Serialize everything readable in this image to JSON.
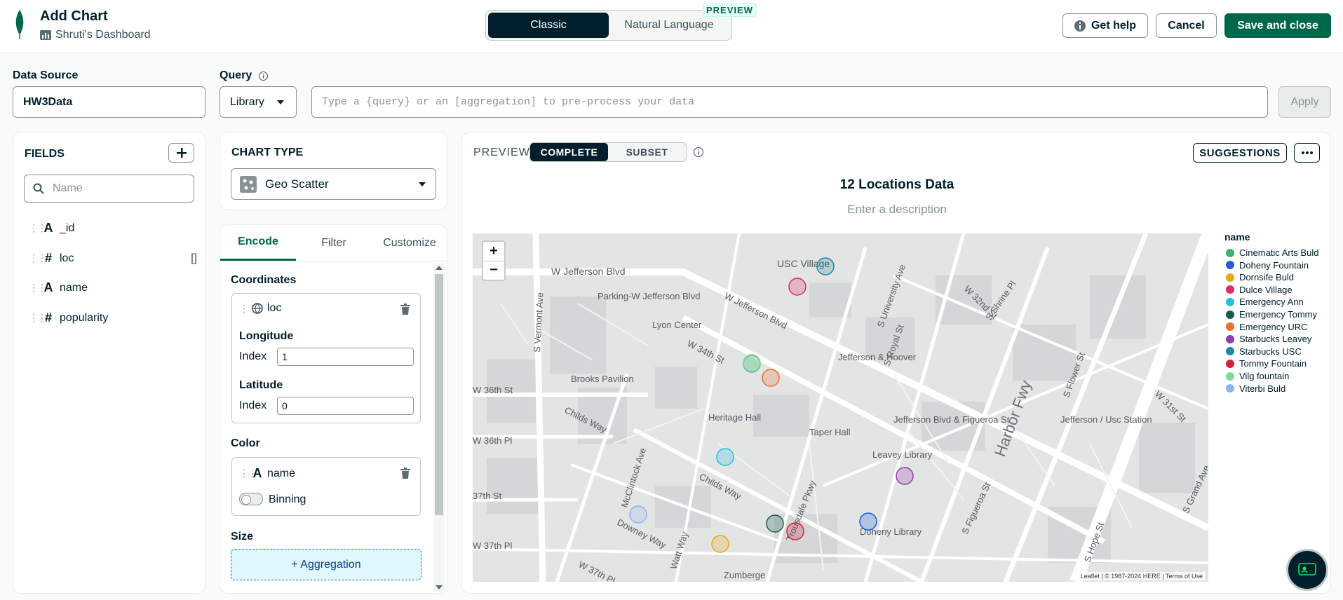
{
  "header": {
    "title": "Add Chart",
    "dashboard": "Shruti's Dashboard",
    "mode_tabs": [
      "Classic",
      "Natural Language"
    ],
    "preview_badge": "PREVIEW",
    "help_label": "Get help",
    "cancel_label": "Cancel",
    "save_label": "Save and close"
  },
  "data_source": {
    "label": "Data Source",
    "value": "HW3Data"
  },
  "query": {
    "label": "Query",
    "library_label": "Library",
    "placeholder": "Type a {query} or an [aggregation] to pre-process your data",
    "apply_label": "Apply"
  },
  "fields": {
    "header": "FIELDS",
    "search_placeholder": "Name",
    "items": [
      {
        "type": "A",
        "name": "_id"
      },
      {
        "type": "#",
        "name": "loc",
        "suffix": "[]"
      },
      {
        "type": "A",
        "name": "name"
      },
      {
        "type": "#",
        "name": "popularity"
      }
    ]
  },
  "chart_type": {
    "label": "CHART TYPE",
    "value": "Geo Scatter"
  },
  "encode": {
    "tabs": [
      "Encode",
      "Filter",
      "Customize"
    ],
    "coordinates_label": "Coordinates",
    "coord_field": "loc",
    "longitude_label": "Longitude",
    "latitude_label": "Latitude",
    "index_label": "Index",
    "longitude_index": "1",
    "latitude_index": "0",
    "color_label": "Color",
    "color_field": "name",
    "binning_label": "Binning",
    "size_label": "Size",
    "aggregation_label": "+ Aggregation"
  },
  "preview": {
    "label": "PREVIEW",
    "tabs": [
      "COMPLETE",
      "SUBSET"
    ],
    "suggestions_label": "SUGGESTIONS",
    "chart_title": "12 Locations Data",
    "description_placeholder": "Enter a description",
    "zoom_in": "+",
    "zoom_out": "−",
    "attribution": "Leaflet | © 1987-2024 HERE | Terms of Use"
  },
  "map_labels": {
    "usc_village": "USC Village",
    "jefferson_blvd_w": "W Jefferson Blvd",
    "parking": "Parking-W Jefferson Blvd",
    "lyon": "Lyon Center",
    "brooks": "Brooks Pavilion",
    "heritage": "Heritage Hall",
    "taper": "Taper Hall",
    "jefferson_hoover": "Jefferson & Hoover",
    "jefferson_fig": "Jefferson Blvd & Figueroa St",
    "jefferson_usc": "Jefferson / Usc Station",
    "leavey": "Leavey Library",
    "doheny": "Doheny Library",
    "zumberge": "Zumberge",
    "harbor": "Harbor Fwy",
    "vermont": "S Vermont Ave",
    "w36st": "W 36th St",
    "w36pl": "W 36th Pl",
    "w37st": "37th St",
    "w37pl": "W 37th Pl",
    "childs": "Childs Way",
    "mcclintock": "McClintock Ave",
    "w34th": "W 34th St",
    "figueroa": "S Figueroa St",
    "flower": "S Flower St",
    "royal": "S Royal St",
    "univ": "S University Ave",
    "w32nd": "W 32nd St",
    "shrine": "S Shrine Pl",
    "downey": "Downey Way",
    "trousdale": "Trousdale Pkwy",
    "hope": "S Hope St",
    "w31st": "W 31st St",
    "grand": "S Grand Ave",
    "watt": "Watt Way",
    "wjefferson2": "W Jefferson Blvd",
    "w37pl2": "W 37th Pl"
  },
  "chart_data": {
    "type": "scatter",
    "title": "12 Locations Data",
    "legend_title": "name",
    "series": [
      {
        "name": "Cinematic Arts Buld",
        "color": "#3cb371"
      },
      {
        "name": "Doheny Fountain",
        "color": "#1f5fd6"
      },
      {
        "name": "Dornsife Buld",
        "color": "#e6a817"
      },
      {
        "name": "Dulce Village",
        "color": "#e0286b"
      },
      {
        "name": "Emergency Ann",
        "color": "#22c0e0"
      },
      {
        "name": "Emergency Tommy",
        "color": "#1a5c4c"
      },
      {
        "name": "Emergency URC",
        "color": "#e8702a"
      },
      {
        "name": "Starbucks Leavey",
        "color": "#8e3db0"
      },
      {
        "name": "Starbucks USC",
        "color": "#1b8aa6"
      },
      {
        "name": "Tommy Fountain",
        "color": "#d6203a"
      },
      {
        "name": "Vilg fountain",
        "color": "#7ed99a"
      },
      {
        "name": "Viterbi Buld",
        "color": "#8fb3f0"
      }
    ]
  }
}
